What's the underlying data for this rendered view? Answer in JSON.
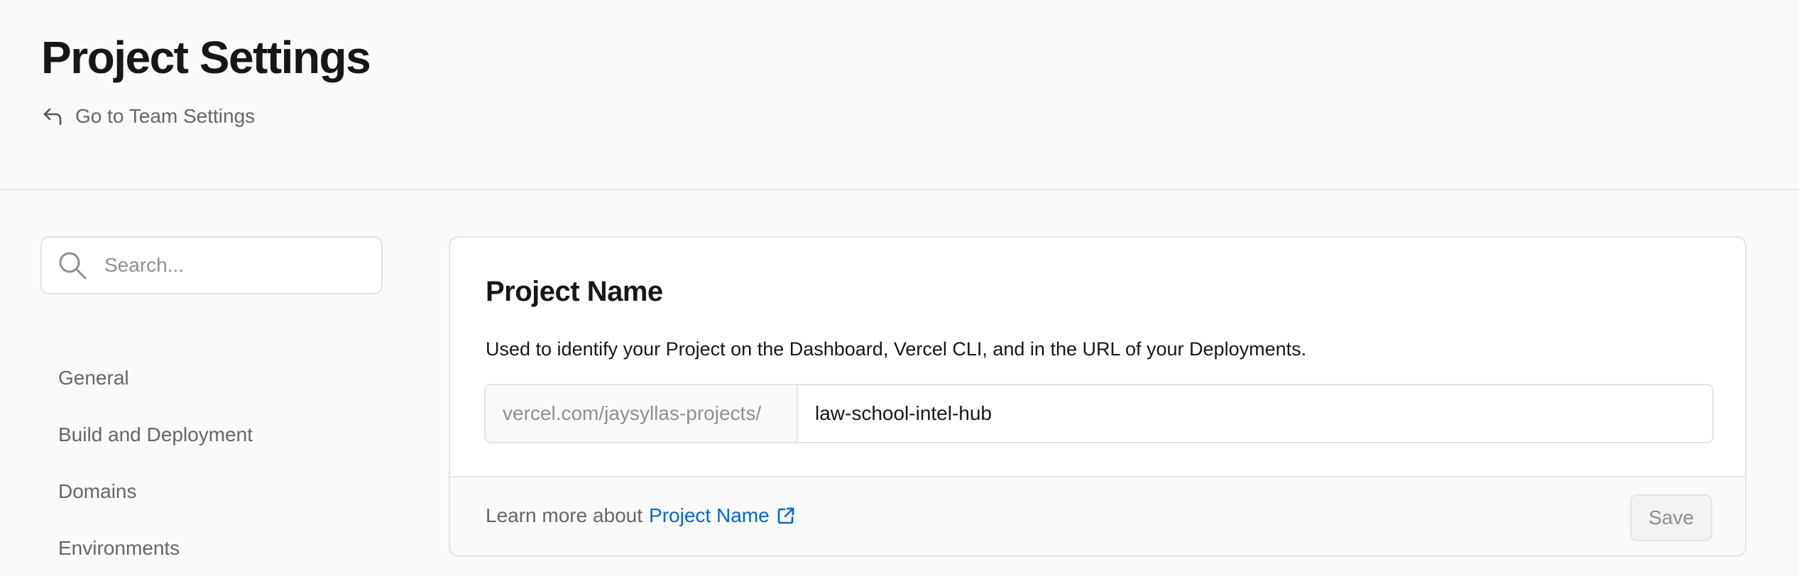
{
  "header": {
    "title": "Project Settings",
    "back_link_label": "Go to Team Settings",
    "back_icon": "return-arrow-icon"
  },
  "sidebar": {
    "search": {
      "placeholder": "Search...",
      "value": "",
      "icon": "search-icon"
    },
    "items": [
      {
        "label": "General"
      },
      {
        "label": "Build and Deployment"
      },
      {
        "label": "Domains"
      },
      {
        "label": "Environments"
      }
    ]
  },
  "project_name_card": {
    "title": "Project Name",
    "description": "Used to identify your Project on the Dashboard, Vercel CLI, and in the URL of your Deployments.",
    "url_prefix": "vercel.com/jaysyllas-projects/",
    "value": "law-school-intel-hub",
    "footer": {
      "learn_more_text": "Learn more about",
      "link_label": "Project Name",
      "link_icon": "external-link-icon"
    },
    "save_label": "Save"
  },
  "colors": {
    "background": "#fafafa",
    "card": "#ffffff",
    "border": "#e5e5e5",
    "link": "#0068d6",
    "text_primary": "#171717",
    "text_secondary": "#666666",
    "text_muted": "#8f8f8f"
  }
}
